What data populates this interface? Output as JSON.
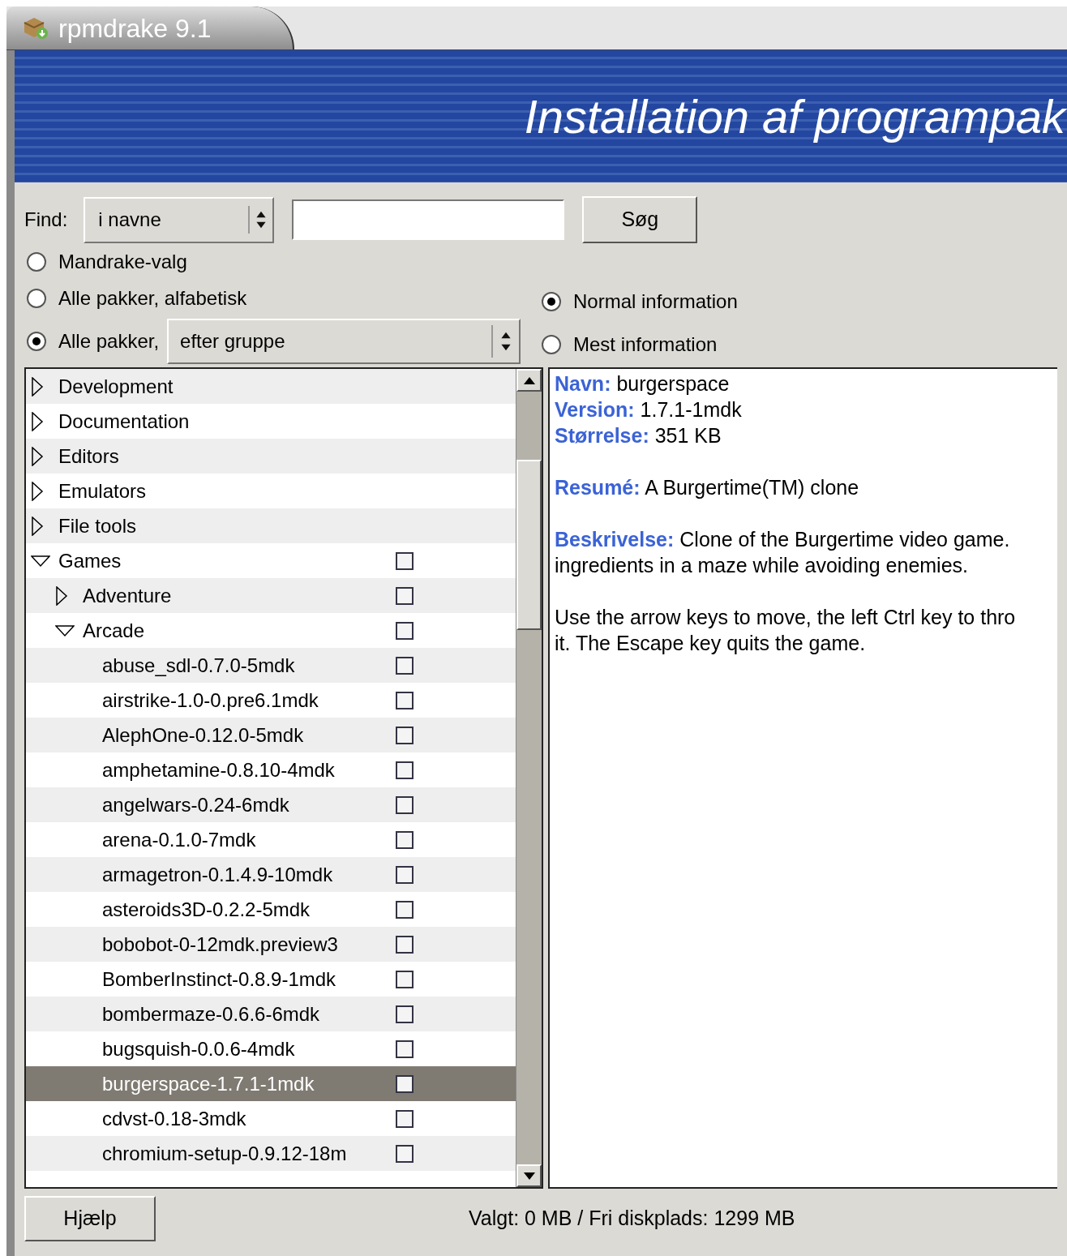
{
  "window": {
    "title": "rpmdrake 9.1"
  },
  "banner": {
    "title": "Installation af programpak"
  },
  "find": {
    "label": "Find:",
    "scope": "i navne",
    "button": "Søg"
  },
  "view_modes": [
    {
      "label": "Mandrake-valg",
      "selected": false
    },
    {
      "label": "Alle pakker, alfabetisk",
      "selected": false
    },
    {
      "label": "Alle pakker,",
      "selected": true,
      "dropdown": "efter gruppe"
    }
  ],
  "info_modes": [
    {
      "label": "Normal information",
      "selected": true
    },
    {
      "label": "Mest information",
      "selected": false
    }
  ],
  "tree": [
    {
      "kind": "group",
      "label": "Development",
      "expanded": false,
      "selected": false
    },
    {
      "kind": "group",
      "label": "Documentation",
      "expanded": false,
      "selected": false
    },
    {
      "kind": "group",
      "label": "Editors",
      "expanded": false,
      "selected": false
    },
    {
      "kind": "group",
      "label": "Emulators",
      "expanded": false,
      "selected": false
    },
    {
      "kind": "group",
      "label": "File tools",
      "expanded": false,
      "selected": false
    },
    {
      "kind": "group",
      "label": "Games",
      "expanded": true,
      "selected": false,
      "checked": false,
      "children": [
        {
          "kind": "group",
          "label": "Adventure",
          "expanded": false,
          "selected": false,
          "checked": false
        },
        {
          "kind": "group",
          "label": "Arcade",
          "expanded": true,
          "selected": false,
          "checked": false,
          "children": [
            {
              "kind": "package",
              "label": "abuse_sdl-0.7.0-5mdk",
              "selected": false,
              "checked": false
            },
            {
              "kind": "package",
              "label": "airstrike-1.0-0.pre6.1mdk",
              "selected": false,
              "checked": false
            },
            {
              "kind": "package",
              "label": "AlephOne-0.12.0-5mdk",
              "selected": false,
              "checked": false
            },
            {
              "kind": "package",
              "label": "amphetamine-0.8.10-4mdk",
              "selected": false,
              "checked": false
            },
            {
              "kind": "package",
              "label": "angelwars-0.24-6mdk",
              "selected": false,
              "checked": false
            },
            {
              "kind": "package",
              "label": "arena-0.1.0-7mdk",
              "selected": false,
              "checked": false
            },
            {
              "kind": "package",
              "label": "armagetron-0.1.4.9-10mdk",
              "selected": false,
              "checked": false
            },
            {
              "kind": "package",
              "label": "asteroids3D-0.2.2-5mdk",
              "selected": false,
              "checked": false
            },
            {
              "kind": "package",
              "label": "bobobot-0-12mdk.preview3",
              "selected": false,
              "checked": false
            },
            {
              "kind": "package",
              "label": "BomberInstinct-0.8.9-1mdk",
              "selected": false,
              "checked": false
            },
            {
              "kind": "package",
              "label": "bombermaze-0.6.6-6mdk",
              "selected": false,
              "checked": false
            },
            {
              "kind": "package",
              "label": "bugsquish-0.0.6-4mdk",
              "selected": false,
              "checked": false
            },
            {
              "kind": "package",
              "label": "burgerspace-1.7.1-1mdk",
              "selected": true,
              "checked": false
            },
            {
              "kind": "package",
              "label": "cdvst-0.18-3mdk",
              "selected": false,
              "checked": false
            },
            {
              "kind": "package",
              "label": "chromium-setup-0.9.12-18m",
              "selected": false,
              "checked": false
            }
          ]
        }
      ]
    }
  ],
  "info": {
    "fields": [
      {
        "label": "Navn:",
        "value": "burgerspace"
      },
      {
        "label": "Version:",
        "value": "1.7.1-1mdk"
      },
      {
        "label": "Størrelse:",
        "value": "351 KB"
      }
    ],
    "summary": {
      "label": "Resumé:",
      "value": "A Burgertime(TM) clone"
    },
    "description": {
      "label": "Beskrivelse:",
      "paragraphs": [
        [
          "Clone of the Burgertime video game.",
          "ingredients in a maze while avoiding enemies."
        ],
        [
          "Use the arrow keys to move, the left Ctrl key to thro",
          "it. The Escape key quits the game."
        ]
      ]
    }
  },
  "help_button": "Hjælp",
  "status": "Valgt: 0 MB / Fri diskplads: 1299 MB"
}
